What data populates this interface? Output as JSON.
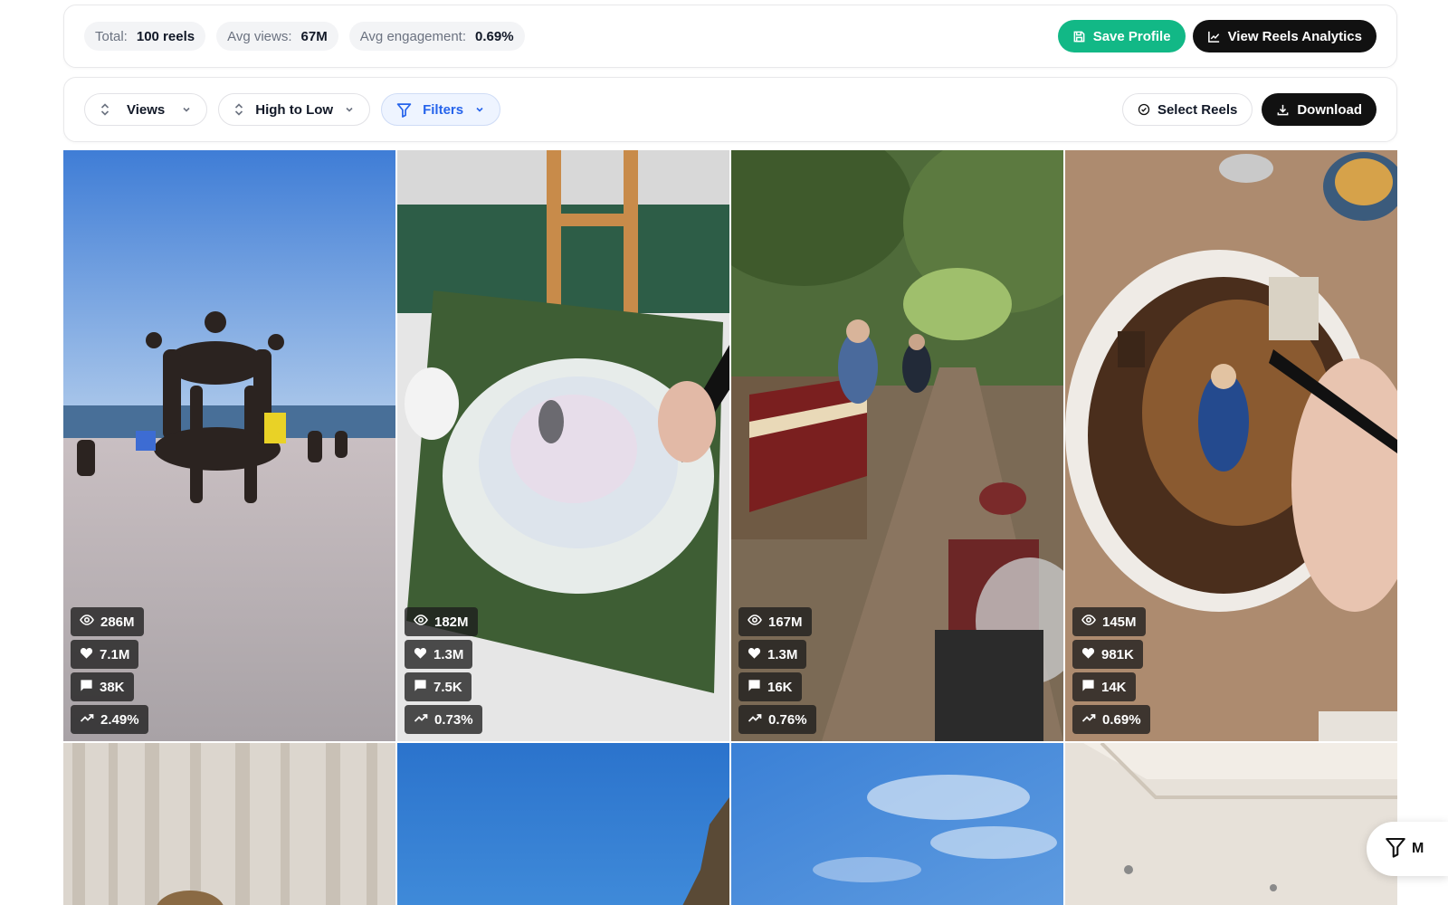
{
  "stats": {
    "total": {
      "label": "Total:",
      "value": "100 reels"
    },
    "avg_views": {
      "label": "Avg views:",
      "value": "67M"
    },
    "avg_engagement": {
      "label": "Avg engagement:",
      "value": "0.69%"
    }
  },
  "actions": {
    "save_profile": "Save Profile",
    "view_analytics": "View Reels Analytics"
  },
  "toolbar": {
    "sort_field": "Views",
    "sort_order": "High to Low",
    "filters": "Filters",
    "select_reels": "Select Reels",
    "download": "Download"
  },
  "colors": {
    "accent_green": "#12b886",
    "accent_blue": "#2563eb",
    "dark": "#111111"
  },
  "reels": [
    {
      "scene": "beach-acrobatics",
      "views": "286M",
      "likes": "7.1M",
      "comments": "38K",
      "engagement": "2.49%"
    },
    {
      "scene": "clay-snake",
      "views": "182M",
      "likes": "1.3M",
      "comments": "7.5K",
      "engagement": "0.73%"
    },
    {
      "scene": "miniature-train",
      "views": "167M",
      "likes": "1.3M",
      "comments": "16K",
      "engagement": "0.76%"
    },
    {
      "scene": "egg-painting",
      "views": "145M",
      "likes": "981K",
      "comments": "14K",
      "engagement": "0.69%"
    }
  ],
  "next_row": [
    {
      "scene": "curtains"
    },
    {
      "scene": "blue-sky-cliff"
    },
    {
      "scene": "blue-sky-clouds"
    },
    {
      "scene": "ceiling"
    }
  ],
  "fab": {
    "label": "M"
  }
}
